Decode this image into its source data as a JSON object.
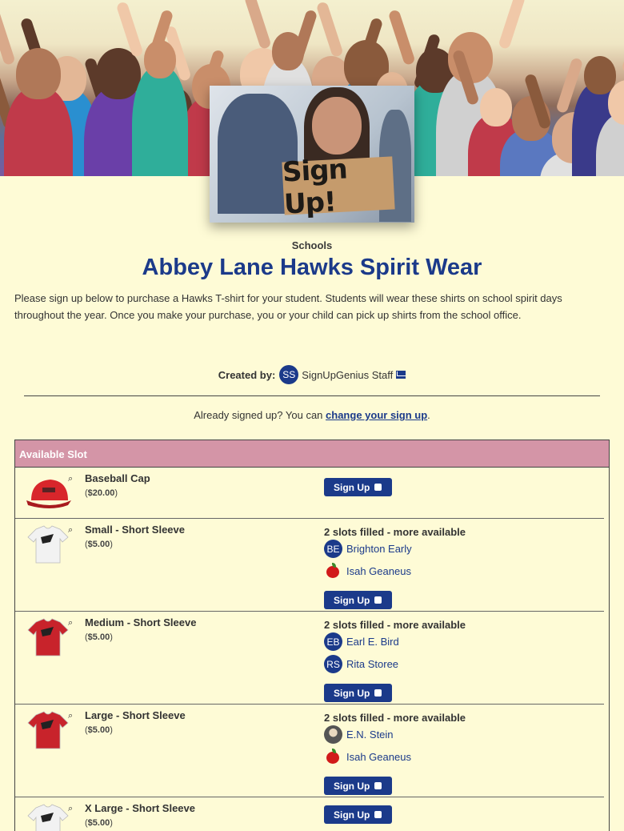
{
  "banner": {
    "sign_text": "Sign Up!"
  },
  "header": {
    "category": "Schools",
    "title": "Abbey Lane Hawks Spirit Wear",
    "description": "Please sign up below to purchase a Hawks T-shirt for your student. Students will wear these shirts on school spirit days throughout the year.  Once you make your purchase, you or your child can pick up shirts from the school office."
  },
  "creator": {
    "label": "Created by:",
    "initials": "SS",
    "name": "SignUpGenius Staff"
  },
  "already": {
    "text": "Already signed up? You can ",
    "link": "change your sign up",
    "suffix": "."
  },
  "table": {
    "header": "Available Slot",
    "signup_label": "Sign Up",
    "colors": {
      "accent": "#1b3a8a",
      "header_bg": "#d495a7",
      "page_bg": "#fefbd6"
    },
    "rows": [
      {
        "name": "Baseball Cap",
        "price": "$20.00",
        "product": "cap",
        "color": "#d8262b"
      },
      {
        "name": "Small - Short Sleeve",
        "price": "$5.00",
        "product": "tshirt",
        "color": "#f2f2f2",
        "status": "2 slots filled - more available",
        "participants": [
          {
            "initials": "BE",
            "name": "Brighton Early"
          },
          {
            "avatar": "apple-icon",
            "name": "Isah Geaneus"
          }
        ]
      },
      {
        "name": "Medium - Short Sleeve",
        "price": "$5.00",
        "product": "tshirt",
        "color": "#c8232b",
        "status": "2 slots filled - more available",
        "participants": [
          {
            "initials": "EB",
            "name": "Earl E. Bird"
          },
          {
            "initials": "RS",
            "name": "Rita Storee"
          }
        ]
      },
      {
        "name": "Large - Short Sleeve",
        "price": "$5.00",
        "product": "tshirt",
        "color": "#c8232b",
        "status": "2 slots filled - more available",
        "participants": [
          {
            "avatar": "portrait-photo",
            "name": "E.N. Stein"
          },
          {
            "avatar": "apple-icon",
            "name": "Isah Geaneus"
          }
        ]
      },
      {
        "name": "X Large - Short Sleeve",
        "price": "$5.00",
        "product": "tshirt",
        "color": "#f2f2f2"
      }
    ]
  }
}
